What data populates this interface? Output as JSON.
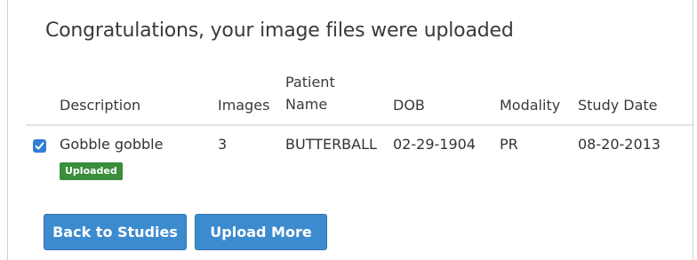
{
  "dialog": {
    "title": "Congratulations, your image files were uploaded"
  },
  "table": {
    "headers": {
      "description": "Description",
      "images": "Images",
      "patient_name_line1": "Patient",
      "patient_name_line2": "Name",
      "dob": "DOB",
      "modality": "Modality",
      "study_date": "Study Date"
    },
    "rows": [
      {
        "checked": true,
        "description": "Gobble gobble",
        "status": "Uploaded",
        "images": "3",
        "patient_name": "BUTTERBALL",
        "dob": "02-29-1904",
        "modality": "PR",
        "study_date": "08-20-2013"
      }
    ]
  },
  "buttons": {
    "back_to_studies": "Back to Studies",
    "upload_more": "Upload More"
  },
  "colors": {
    "primary_button": "#3d8bcf",
    "checkbox": "#2f7fd6",
    "uploaded_badge": "#3a8d3a"
  }
}
